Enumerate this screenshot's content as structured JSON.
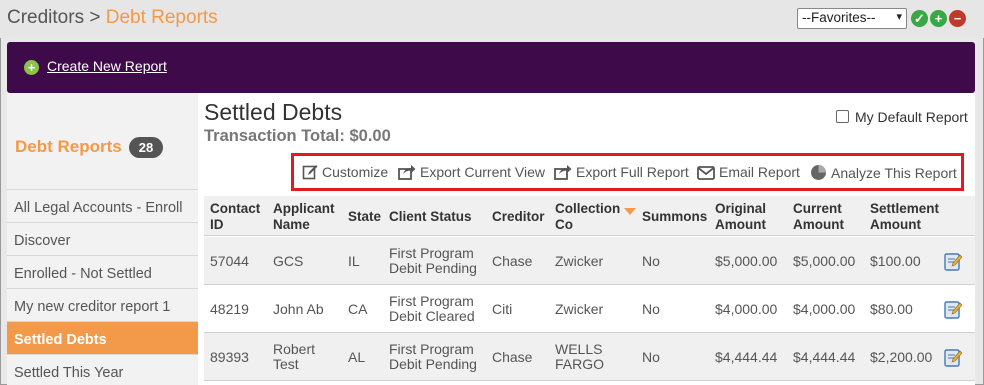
{
  "breadcrumb": {
    "parent": "Creditors",
    "separator": " > ",
    "current": "Debt Reports"
  },
  "favorites": {
    "selected": "--Favorites--",
    "arrow": "▾"
  },
  "header_icons": [
    "check-icon",
    "plus-icon",
    "minus-icon"
  ],
  "banner": {
    "create_label": "Create New Report",
    "background": "#3e0a4a"
  },
  "sidebar": {
    "title": "Debt Reports",
    "count": "28",
    "items": [
      {
        "label": "All Legal Accounts - Enroll"
      },
      {
        "label": "Discover"
      },
      {
        "label": "Enrolled - Not Settled"
      },
      {
        "label": "My new creditor report 1"
      },
      {
        "label": "Settled Debts"
      },
      {
        "label": "Settled This Year"
      }
    ]
  },
  "report": {
    "title": "Settled Debts",
    "total": "Transaction Total: $0.00",
    "default_label": "My Default Report"
  },
  "toolbar": {
    "customize": "Customize",
    "export_current": "Export Current View",
    "export_full": "Export Full Report",
    "email": "Email Report",
    "analyze": "Analyze This Report"
  },
  "table": {
    "headers": {
      "contact_id": [
        "Contact",
        "ID"
      ],
      "applicant": [
        "Applicant",
        "Name"
      ],
      "state": [
        "State"
      ],
      "status": [
        "Client Status"
      ],
      "creditor": [
        "Creditor"
      ],
      "collection": [
        "Collection",
        "Co"
      ],
      "summons": [
        "Summons"
      ],
      "original": [
        "Original",
        "Amount"
      ],
      "current": [
        "Current",
        "Amount"
      ],
      "settlement": [
        "Settlement",
        "Amount"
      ]
    },
    "rows": [
      {
        "contact_id": "57044",
        "applicant": [
          "GCS",
          ""
        ],
        "state": "IL",
        "status": [
          "First Program",
          "Debit Pending"
        ],
        "creditor": "Chase",
        "collection": [
          "Zwicker",
          ""
        ],
        "summons": "No",
        "original": "$5,000.00",
        "current": "$5,000.00",
        "settlement": "$100.00"
      },
      {
        "contact_id": "48219",
        "applicant": [
          "John Ab",
          ""
        ],
        "state": "CA",
        "status": [
          "First Program",
          "Debit Cleared"
        ],
        "creditor": "Citi",
        "collection": [
          "Zwicker",
          ""
        ],
        "summons": "No",
        "original": "$4,000.00",
        "current": "$4,000.00",
        "settlement": "$80.00"
      },
      {
        "contact_id": "89393",
        "applicant": [
          "Robert",
          "Test"
        ],
        "state": "AL",
        "status": [
          "First Program",
          "Debit Pending"
        ],
        "creditor": "Chase",
        "collection": [
          "WELLS",
          "FARGO"
        ],
        "summons": "No",
        "original": "$4,444.44",
        "current": "$4,444.44",
        "settlement": "$2,200.00"
      }
    ]
  },
  "colors": {
    "accent": "#f39a4a",
    "toolbar_border": "#e01b22"
  }
}
